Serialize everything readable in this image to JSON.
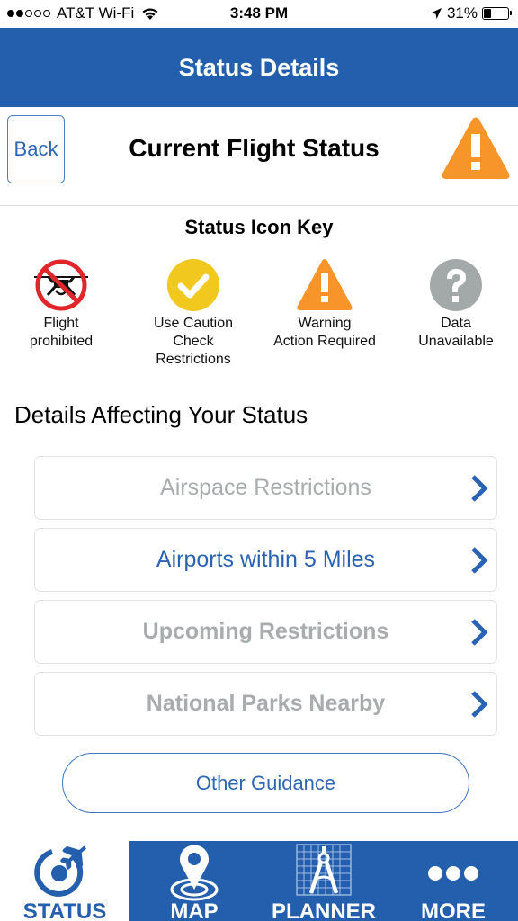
{
  "status_bar": {
    "signal_filled": 2,
    "signal_total": 5,
    "carrier": "AT&T Wi-Fi",
    "time": "3:48 PM",
    "battery_percent_label": "31%",
    "battery_level": 0.31
  },
  "header": {
    "title": "Status Details"
  },
  "flight_status": {
    "back_label": "Back",
    "title": "Current Flight Status",
    "current_icon": "warning-icon",
    "current_icon_color": "#f7942a"
  },
  "icon_key": {
    "title": "Status Icon Key",
    "items": [
      {
        "icon": "no-drone-icon",
        "label_line1": "Flight",
        "label_line2": "prohibited",
        "label_line3": "",
        "color": "#e0262b"
      },
      {
        "icon": "caution-check-icon",
        "label_line1": "Use Caution",
        "label_line2": "Check",
        "label_line3": "Restrictions",
        "color": "#f0c81e"
      },
      {
        "icon": "warning-icon",
        "label_line1": "Warning",
        "label_line2": "Action Required",
        "label_line3": "",
        "color": "#f7942a"
      },
      {
        "icon": "question-icon",
        "label_line1": "Data",
        "label_line2": "Unavailable",
        "label_line3": "",
        "color": "#a3a8a9"
      }
    ]
  },
  "details": {
    "title": "Details Affecting Your Status",
    "items": [
      {
        "label": "Airspace Restrictions",
        "state": "disabled"
      },
      {
        "label": "Airports within 5 Miles",
        "state": "enabled"
      },
      {
        "label": "Upcoming Restrictions",
        "state": "disabled"
      },
      {
        "label": "National Parks Nearby",
        "state": "disabled"
      }
    ],
    "guidance_label": "Other Guidance"
  },
  "tabbar": {
    "items": [
      {
        "label": "STATUS",
        "icon": "status-plane-icon",
        "active": true
      },
      {
        "label": "MAP",
        "icon": "map-pin-icon",
        "active": false
      },
      {
        "label": "PLANNER",
        "icon": "planner-compass-icon",
        "active": false
      },
      {
        "label": "MORE",
        "icon": "more-dots-icon",
        "active": false
      }
    ]
  },
  "colors": {
    "brand_blue": "#245fae",
    "link_blue": "#2b63b2",
    "disabled_gray": "#a8acad",
    "warning_orange": "#f7942a"
  }
}
